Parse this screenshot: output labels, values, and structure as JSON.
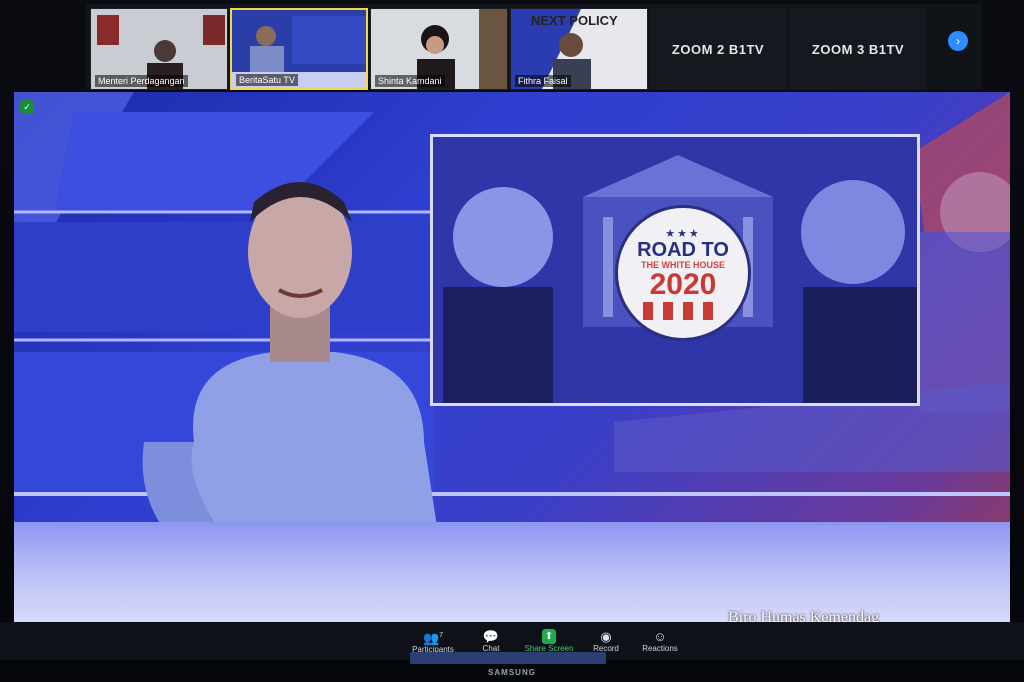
{
  "participants": [
    {
      "name": "Menteri Perdagangan",
      "active": false
    },
    {
      "name": "BeritaSatu TV",
      "active": true
    },
    {
      "name": "Shinta Kamdani",
      "active": false
    },
    {
      "name": "Fithra Faisal",
      "active": false
    }
  ],
  "tile4_overlay": "NEXT POLICY",
  "text_tiles": [
    "ZOOM 2 B1TV",
    "ZOOM 3 B1TV"
  ],
  "next_arrow": "›",
  "inset_badge": {
    "line1": "ROAD TO",
    "line2": "THE WHITE HOUSE",
    "line3": "2020"
  },
  "toolbar": {
    "participants_label": "Participants",
    "participants_count": "7",
    "chat_label": "Chat",
    "share_label": "Share Screen",
    "record_label": "Record",
    "reactions_label": "Reactions"
  },
  "photo_caption": "Biro Humas Kemendag",
  "monitor_brand": "SAMSUNG",
  "colors": {
    "accent_blue": "#2d8cff",
    "share_green": "#21a94e",
    "active_speaker": "#f2d64b"
  }
}
